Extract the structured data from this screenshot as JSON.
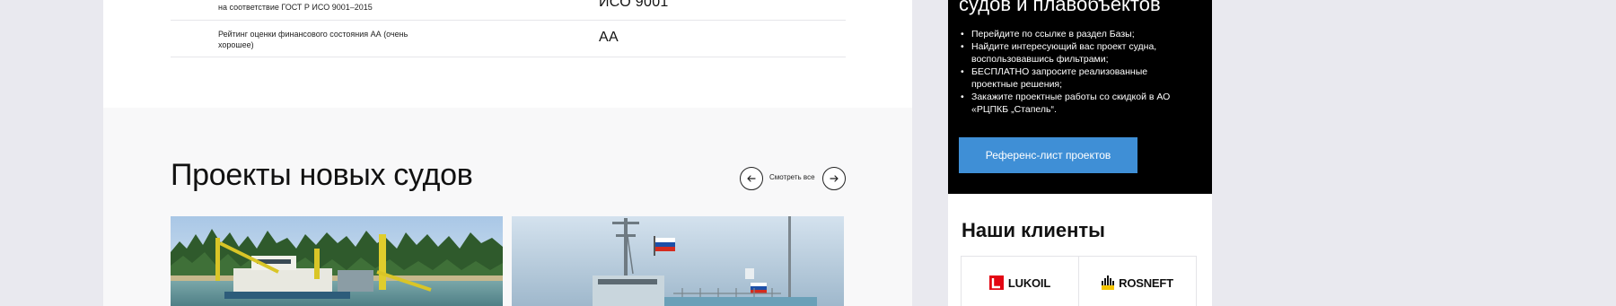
{
  "specs": {
    "rows": [
      {
        "label": "на соответствие ГОСТ Р ИСО 9001–2015",
        "value": "ИСО 9001"
      },
      {
        "label": "Рейтинг оценки финансового состояния АА (очень хорошее)",
        "value": "АА"
      }
    ]
  },
  "projects": {
    "title": "Проекты новых судов",
    "view_all": "Смотреть все",
    "prev_icon": "arrow-left-icon",
    "next_icon": "arrow-right-icon"
  },
  "sidebar": {
    "heading": "судов и плавобъектов",
    "steps": [
      "Перейдите по ссылке в раздел Базы;",
      "Найдите интересующий вас проект судна, воспользовавшись фильтрами;",
      "БЕСПЛАТНО запросите реализованные проектные решения;",
      "Закажите проектные работы со скидкой в АО «РЦПКБ „Стапель“."
    ],
    "button_label": "Референс-лист проектов",
    "button_color": "#3f8fd6"
  },
  "clients": {
    "title": "Наши клиенты",
    "logos": [
      {
        "name": "LUKOIL",
        "color": "#e30613"
      },
      {
        "name": "ROSNEFT",
        "color": "#f6c600"
      }
    ]
  }
}
